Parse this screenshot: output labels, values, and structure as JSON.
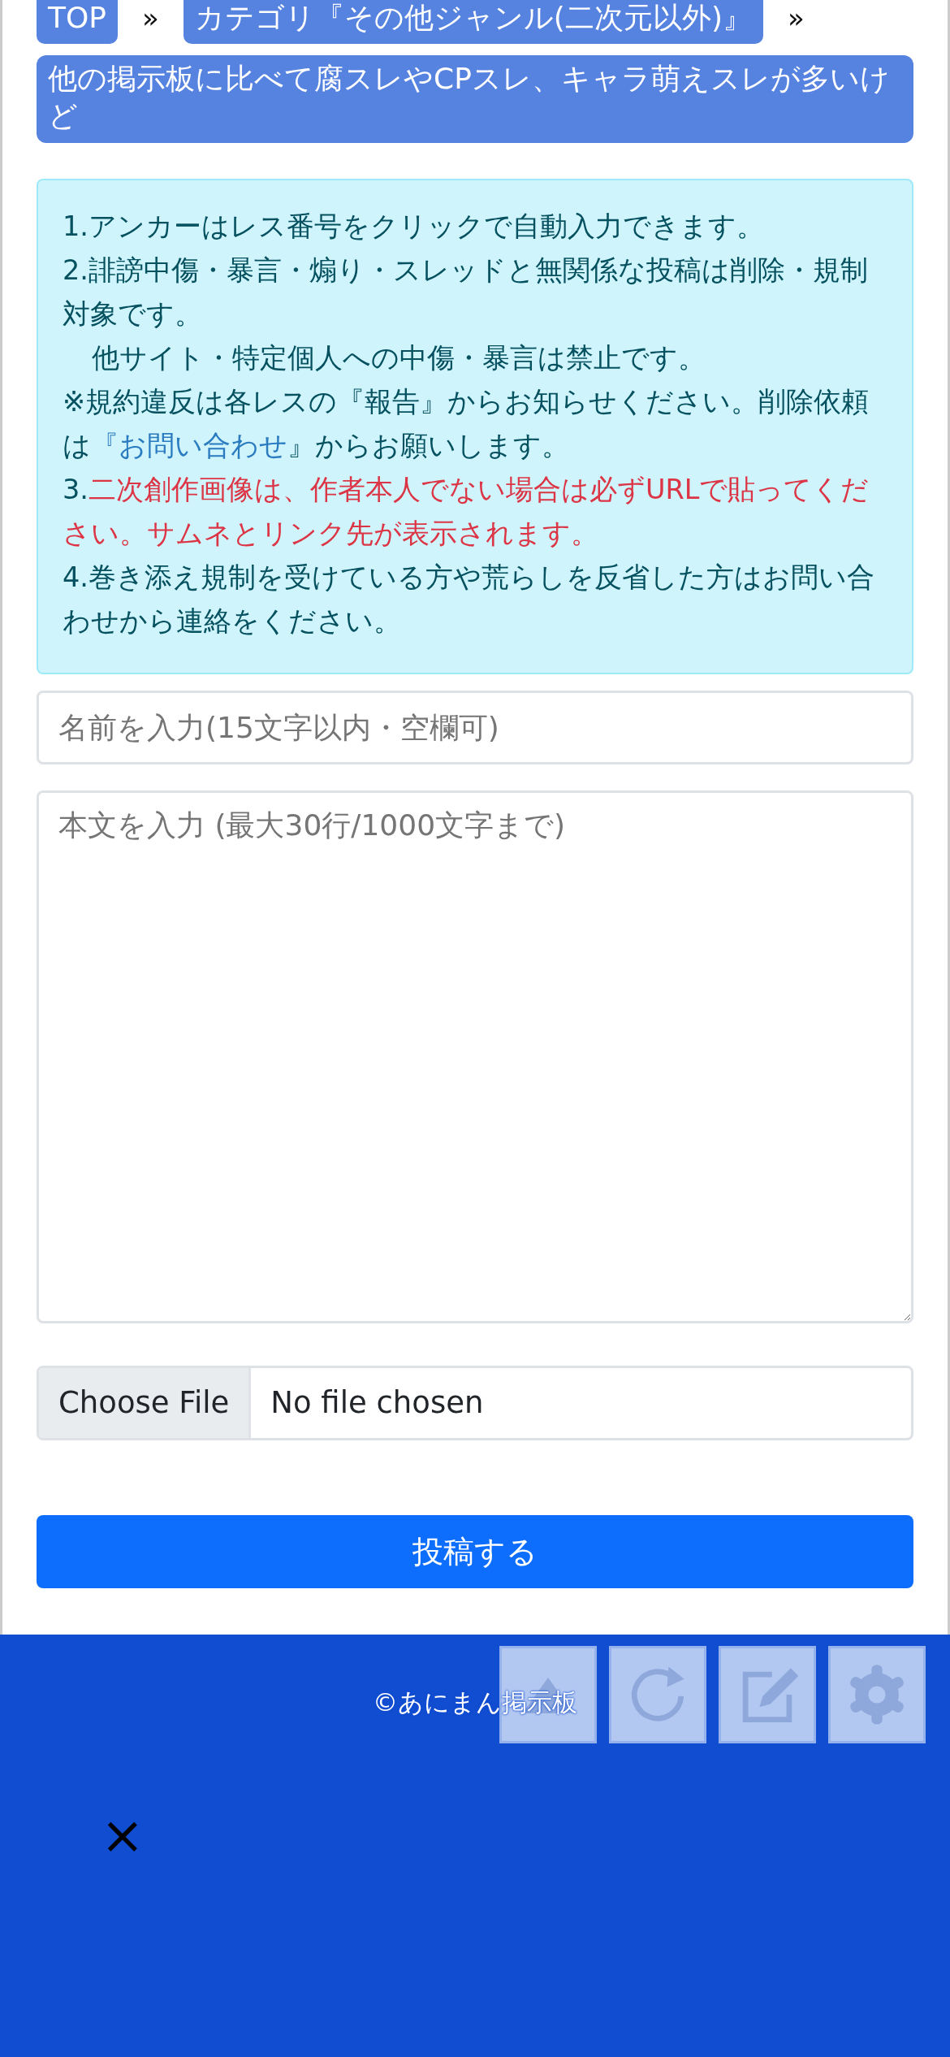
{
  "breadcrumb": [
    {
      "label": "TOP"
    },
    {
      "label": "カテゴリ『その他ジャンル(二次元以外)』"
    }
  ],
  "breadcrumb_separator": "»",
  "thread_title": "他の掲示板に比べて腐スレやCPスレ、キャラ萌えスレが多いけど",
  "notices": [
    {
      "kind": "plain",
      "text": "1.アンカーはレス番号をクリックで自動入力できます。"
    },
    {
      "kind": "plain",
      "text": "2.誹謗中傷・暴言・煽り・スレッドと無関係な投稿は削除・規制対象です。"
    },
    {
      "kind": "indent",
      "text": "他サイト・特定個人への中傷・暴言は禁止です。"
    },
    {
      "kind": "link",
      "before": "※規約違反は各レスの『報告』からお知らせください。削除依頼は",
      "link": "『お問い合わせ",
      "after": "』からお願いします。"
    },
    {
      "kind": "warning",
      "number": "3.",
      "text": "二次創作画像は、作者本人でない場合は必ずURLで貼ってください。サムネとリンク先が表示されます。"
    },
    {
      "kind": "plain",
      "text": "4.巻き添え規制を受けている方や荒らしを反省した方はお問い合わせから連絡をください。"
    }
  ],
  "form": {
    "name_placeholder": "名前を入力(15文字以内・空欄可)",
    "body_placeholder": "本文を入力 (最大30行/1000文字まで)",
    "file_button": "Choose File",
    "file_status": "No file chosen",
    "submit": "投稿する"
  },
  "footer": {
    "copyright": "©あにまん掲示板"
  },
  "floating_buttons": [
    {
      "kind": "up"
    },
    {
      "kind": "reload"
    },
    {
      "kind": "write"
    },
    {
      "kind": "settings"
    }
  ],
  "close_mark": "×"
}
